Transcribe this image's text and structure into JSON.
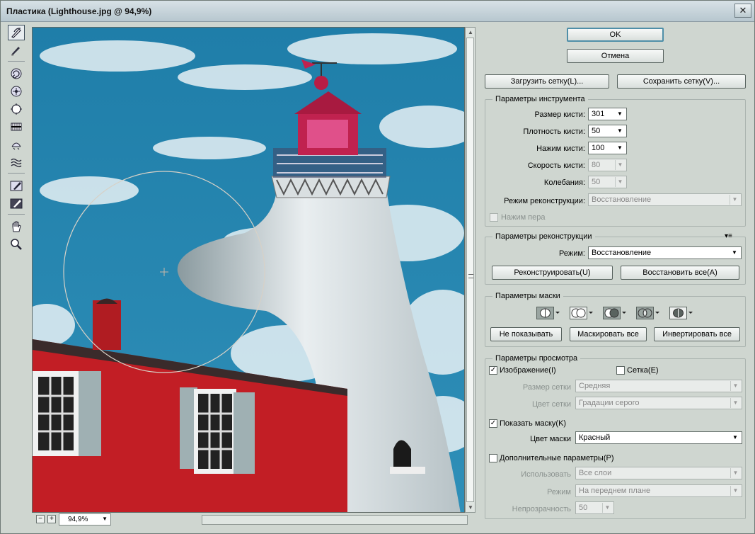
{
  "window": {
    "title": "Пластика (Lighthouse.jpg @ 94,9%)",
    "close_glyph": "✕"
  },
  "tools": [
    "forward-warp-icon",
    "reconstruct-icon",
    "twirl-icon",
    "pucker-icon",
    "bloat-icon",
    "push-left-icon",
    "mirror-icon",
    "turbulence-icon",
    "freeze-mask-icon",
    "thaw-mask-icon",
    "hand-icon",
    "zoom-icon"
  ],
  "canvas": {
    "zoom_value": "94,9%",
    "zoom_out_label": "−",
    "zoom_in_label": "+"
  },
  "buttons": {
    "ok": "OK",
    "cancel": "Отмена",
    "load_mesh": "Загрузить сетку(L)...",
    "save_mesh": "Сохранить сетку(V)..."
  },
  "tool_options": {
    "legend": "Параметры инструмента",
    "brush_size_label": "Размер кисти:",
    "brush_size": "301",
    "brush_density_label": "Плотность кисти:",
    "brush_density": "50",
    "brush_pressure_label": "Нажим кисти:",
    "brush_pressure": "100",
    "brush_rate_label": "Скорость кисти:",
    "brush_rate": "80",
    "turbulent_jitter_label": "Колебания:",
    "turbulent_jitter": "50",
    "reconstruct_mode_label": "Режим реконструкции:",
    "reconstruct_mode": "Восстановление",
    "stylus_pressure_label": "Нажим пера"
  },
  "reconstruct_options": {
    "legend": "Параметры реконструкции",
    "menu_glyph": "▾≡",
    "mode_label": "Режим:",
    "mode": "Восстановление",
    "reconstruct_button": "Реконструировать(U)",
    "restore_all_button": "Восстановить все(A)"
  },
  "mask_options": {
    "legend": "Параметры маски",
    "none_button": "Не показывать",
    "mask_all_button": "Маскировать все",
    "invert_all_button": "Инвертировать все"
  },
  "view_options": {
    "legend": "Параметры просмотра",
    "show_image_label": "Изображение(I)",
    "show_image": true,
    "show_mesh_label": "Сетка(E)",
    "show_mesh": false,
    "mesh_size_label": "Размер сетки",
    "mesh_size": "Средняя",
    "mesh_color_label": "Цвет сетки",
    "mesh_color": "Градации серого",
    "show_mask_label": "Показать маску(K)",
    "show_mask": true,
    "mask_color_label": "Цвет маски",
    "mask_color": "Красный",
    "show_backdrop_label": "Дополнительные параметры(P)",
    "show_backdrop": false,
    "use_label": "Использовать",
    "use": "Все слои",
    "backdrop_mode_label": "Режим",
    "backdrop_mode": "На переднем плане",
    "opacity_label": "Непрозрачность",
    "opacity": "50"
  },
  "glyphs": {
    "dropdown": "▼",
    "check": "✓",
    "up": "▲",
    "down": "▼"
  }
}
